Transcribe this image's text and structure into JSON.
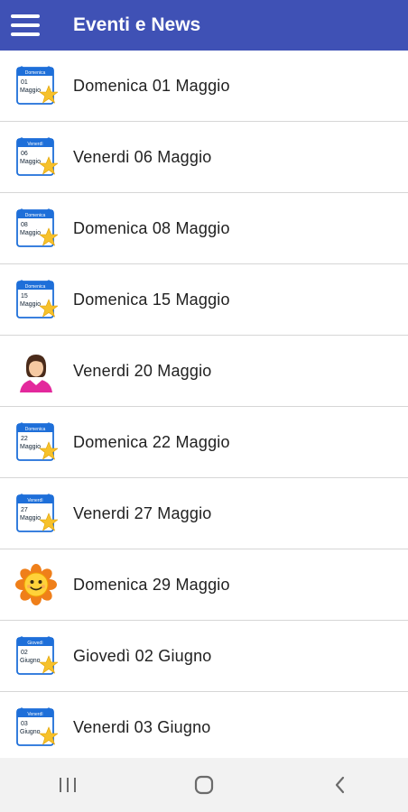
{
  "appbar": {
    "title": "Eventi e News"
  },
  "items": [
    {
      "label": "Domenica 01 Maggio",
      "icon": "calendar-icon",
      "cal_day": "Domenica",
      "cal_num": "01",
      "cal_month": "Maggio"
    },
    {
      "label": "Venerdi 06 Maggio",
      "icon": "calendar-icon",
      "cal_day": "Venerdì",
      "cal_num": "06",
      "cal_month": "Maggio"
    },
    {
      "label": "Domenica 08 Maggio",
      "icon": "calendar-icon",
      "cal_day": "Domenica",
      "cal_num": "08",
      "cal_month": "Maggio"
    },
    {
      "label": "Domenica 15 Maggio",
      "icon": "calendar-icon",
      "cal_day": "Domenica",
      "cal_num": "15",
      "cal_month": "Maggio"
    },
    {
      "label": "Venerdi 20 Maggio",
      "icon": "woman-avatar-icon"
    },
    {
      "label": "Domenica 22 Maggio",
      "icon": "calendar-icon",
      "cal_day": "Domenica",
      "cal_num": "22",
      "cal_month": "Maggio"
    },
    {
      "label": "Venerdi 27 Maggio",
      "icon": "calendar-icon",
      "cal_day": "Venerdì",
      "cal_num": "27",
      "cal_month": "Maggio"
    },
    {
      "label": "Domenica 29 Maggio",
      "icon": "sun-flower-icon"
    },
    {
      "label": "Giovedì 02 Giugno",
      "icon": "calendar-icon",
      "cal_day": "Giovedì",
      "cal_num": "02",
      "cal_month": "Giugno"
    },
    {
      "label": "Venerdi 03 Giugno",
      "icon": "calendar-icon",
      "cal_day": "Venerdì",
      "cal_num": "03",
      "cal_month": "Giugno"
    }
  ],
  "colors": {
    "appbar": "#3F51B5",
    "calendar_header": "#1E6FD9",
    "star": "#F6C12B"
  }
}
